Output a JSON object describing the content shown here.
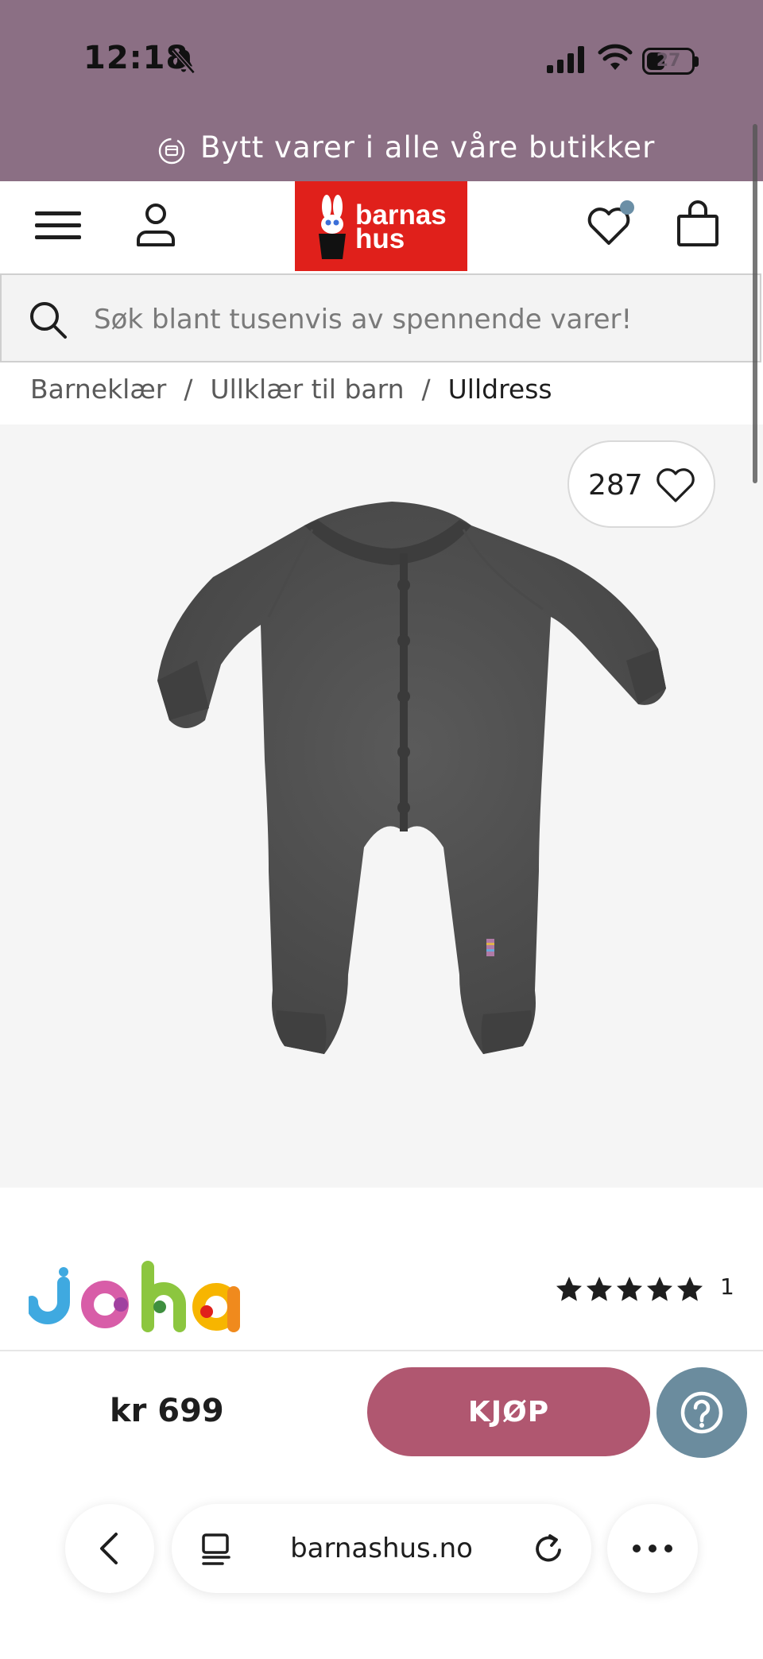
{
  "status_bar": {
    "time": "12:18",
    "battery": "27",
    "icons": [
      "bell-slash-icon",
      "signal-icon",
      "wifi-icon",
      "battery-icon"
    ]
  },
  "promo": {
    "text": "Bytt varer i alle våre butikker",
    "icon": "exchange-icon",
    "background": "#8b6f84"
  },
  "header": {
    "logo_line1": "barnas",
    "logo_line2": "hus",
    "logo_color": "#e0201b",
    "icons": [
      "menu-icon",
      "user-icon",
      "heart-icon",
      "bag-icon"
    ]
  },
  "search": {
    "placeholder": "Søk blant tusenvis av spennende varer!"
  },
  "breadcrumb": {
    "items": [
      "Barneklær",
      "Ullklær til barn",
      "Ulldress"
    ],
    "separator": "/"
  },
  "product": {
    "like_count": "287",
    "brand": "Joha",
    "rating_stars": 5,
    "rating_count": "1",
    "price": "kr 699",
    "buy_label": "KJØP",
    "accent": "#b05770",
    "help_color": "#6b8c9e"
  },
  "browser": {
    "url": "barnashus.no"
  }
}
